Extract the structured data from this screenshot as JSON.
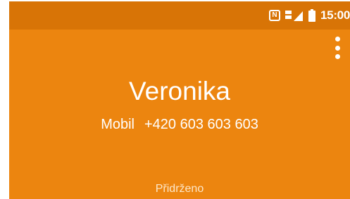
{
  "status_bar": {
    "nfc_label": "N",
    "time": "15:00",
    "icons": [
      "nfc-icon",
      "sim-signal-icon",
      "battery-icon"
    ]
  },
  "contact": {
    "name": "Veronika",
    "number_type": "Mobil",
    "number": "+420 603 603 603"
  },
  "call": {
    "status": "Přidrženo"
  },
  "colors": {
    "screen_background": "#ec850f",
    "status_bar_background": "#d87406",
    "text": "#ffffff"
  },
  "menu": {
    "icon": "overflow-menu-icon"
  }
}
